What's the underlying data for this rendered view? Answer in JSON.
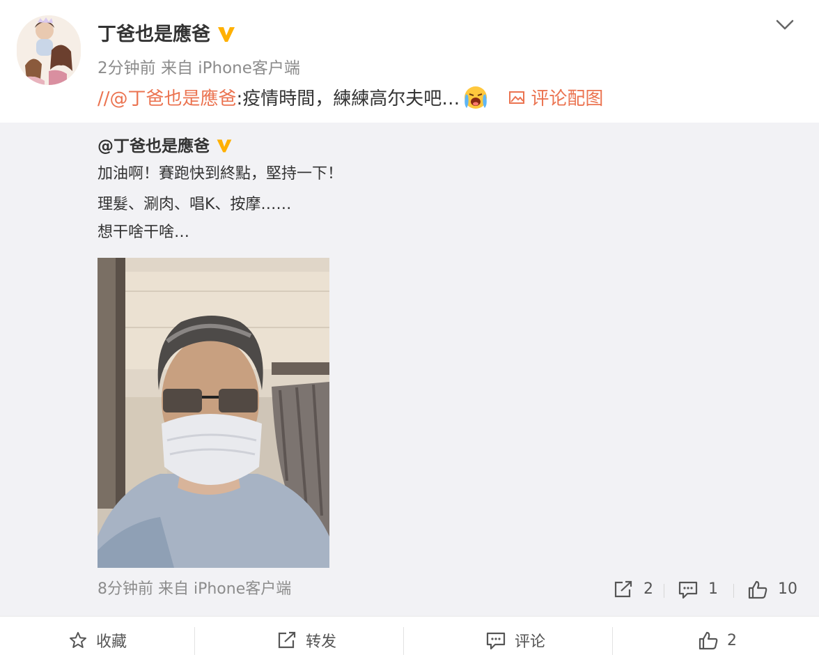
{
  "post": {
    "author": "丁爸也是應爸",
    "meta": "2分钟前 来自 iPhone客户端",
    "repost_slash": "//",
    "repost_mention": "@丁爸也是應爸",
    "repost_text": ":疫情時間，練練高尔夫吧…",
    "comment_pic_label": "评论配图"
  },
  "quoted": {
    "author": "@丁爸也是應爸",
    "lines": [
      "加油啊！賽跑快到終點，堅持一下！",
      "理髮、涮肉、唱K、按摩……",
      "想干啥干啥…"
    ],
    "meta": "8分钟前 来自 iPhone客户端",
    "reposts": "2",
    "comments": "1",
    "likes": "10"
  },
  "toolbar": {
    "favorite": "收藏",
    "repost": "转发",
    "comment": "评论",
    "like": "2"
  },
  "colors": {
    "accent": "#eb7350",
    "verified": "#ffb000",
    "quoted_bg": "#f2f2f5",
    "meta_gray": "#8c8c8c"
  },
  "icons": [
    "chevron-down-icon",
    "verified-badge-icon",
    "crying-emoji-icon",
    "image-icon",
    "repost-icon",
    "comment-icon",
    "like-icon",
    "star-icon"
  ]
}
